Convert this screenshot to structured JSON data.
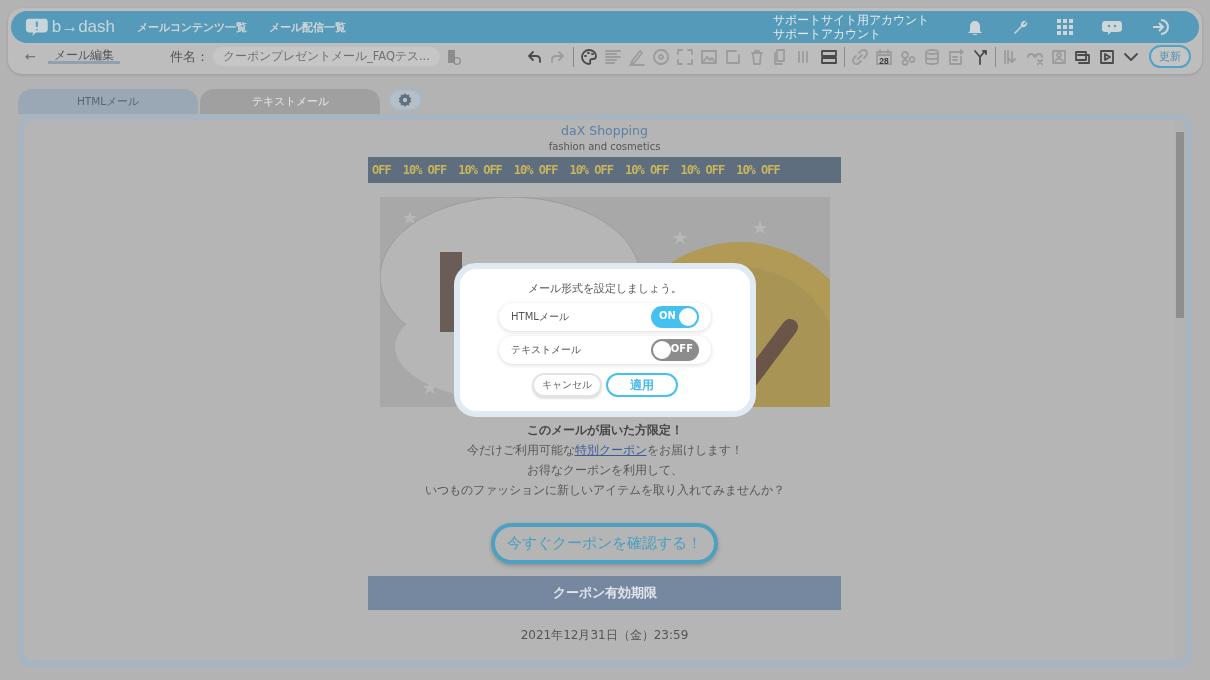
{
  "header": {
    "logo": "b→dash",
    "nav": [
      "メールコンテンツ一覧",
      "メール配信一覧"
    ],
    "account": [
      "サポートサイト用アカウント",
      "サポートアカウント"
    ]
  },
  "toolbar": {
    "back": "←",
    "page_title": "メール編集",
    "subject_label": "件名：",
    "subject_value": "クーポンプレゼントメール_FAQテス...",
    "update_button": "更新",
    "tools": [
      {
        "disabled": false
      },
      {
        "disabled": true
      },
      {
        "disabled": false
      },
      {
        "disabled": true
      },
      {
        "disabled": true
      },
      {
        "disabled": true
      },
      {
        "disabled": true
      },
      {
        "disabled": true
      },
      {
        "disabled": true
      },
      {
        "disabled": true
      },
      {
        "disabled": true
      },
      {
        "disabled": true
      },
      {
        "disabled": false
      },
      {
        "disabled": true
      },
      {
        "disabled": true,
        "label": "28"
      },
      {
        "disabled": true
      },
      {
        "disabled": true
      },
      {
        "disabled": true
      },
      {
        "disabled": false
      },
      {
        "disabled": true
      },
      {
        "disabled": true
      },
      {
        "disabled": true
      },
      {
        "disabled": false
      },
      {
        "disabled": false
      },
      {
        "disabled": false
      }
    ]
  },
  "tabs": [
    {
      "label": "HTMLメール",
      "selected": true
    },
    {
      "label": "テキストメール",
      "selected": false
    }
  ],
  "email": {
    "brand": "daX Shopping",
    "tagline": "fashion and cosmetics",
    "strip": [
      "OFF",
      "10% OFF",
      "10% OFF",
      "10% OFF",
      "10% OFF",
      "10% OFF",
      "10% OFF",
      "10% OFF"
    ],
    "lead": "このメールが届いた方限定！",
    "body": [
      {
        "before": "今だけご利用可能な",
        "link": "特別クーポン",
        "after": "をお届けします！"
      },
      {
        "before": "お得なクーポンを利用して、"
      },
      {
        "before": "いつものファッションに新しいアイテムを取り入れてみませんか？"
      }
    ],
    "cta": "今すぐクーポンを確認する！",
    "section_title": "クーポン有効期限",
    "expiry": "2021年12月31日（金）23:59"
  },
  "dialog": {
    "message": "メール形式を設定しましょう。",
    "options": [
      {
        "label": "HTMLメール",
        "on": true,
        "state_text": "ON"
      },
      {
        "label": "テキストメール",
        "on": false,
        "state_text": "OFF"
      }
    ],
    "cancel": "キャンセル",
    "apply": "適用"
  }
}
